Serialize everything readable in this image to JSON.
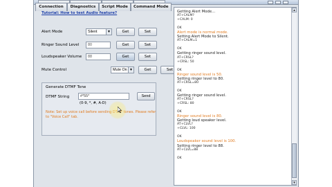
{
  "tabs": {
    "row1": [
      "",
      "",
      "",
      ""
    ],
    "row2": [
      "Connection",
      "Diagnostics",
      "Script Mode",
      "Command Mode"
    ]
  },
  "left": {
    "tutorial_link": "Tutorial: How to test Audio feature?",
    "rows": [
      {
        "label": "Alert Mode",
        "value": "Silent",
        "get": "Get",
        "set": "Set"
      },
      {
        "label": "Ringer Sound Level",
        "value": "80",
        "get": "Get",
        "set": "Set"
      },
      {
        "label": "Loudspeaker Volume",
        "value": "88",
        "get": "Get",
        "set": "Set"
      },
      {
        "label": "Mute Control",
        "value": "Mute On",
        "get": "Get",
        "set": "Set"
      }
    ],
    "dtmf": {
      "title": "Generate DTMF Tone",
      "string_label": "DTMF String",
      "string_value": "#*55*",
      "hint": "(0-9, *, #, A-D)",
      "send": "Send",
      "note": "Note: Set up voice call before sending DTMF tones. Please refer to \"Voice Call\" tab."
    }
  },
  "log": [
    {
      "t": "Getting Alert Mode...",
      "k": "text"
    },
    {
      "t": "AT+CALM?",
      "k": "cmd"
    },
    {
      "t": "+CALM: 0",
      "k": "cmd"
    },
    {
      "t": "",
      "k": "gap"
    },
    {
      "t": "OK",
      "k": "cmd"
    },
    {
      "t": "Alert mode is normal mode.",
      "k": "resp"
    },
    {
      "t": "Setting Alert Mode to Silent.",
      "k": "text"
    },
    {
      "t": "AT+CALM=1",
      "k": "cmd"
    },
    {
      "t": "",
      "k": "gap"
    },
    {
      "t": "OK",
      "k": "cmd"
    },
    {
      "t": "Getting ringer sound level.",
      "k": "text"
    },
    {
      "t": "AT+CRSL?",
      "k": "cmd"
    },
    {
      "t": "+CRSL: 50",
      "k": "cmd"
    },
    {
      "t": "",
      "k": "gap"
    },
    {
      "t": "OK",
      "k": "cmd"
    },
    {
      "t": "Ringer sound level is 50.",
      "k": "resp"
    },
    {
      "t": "Setting ringer level to 80.",
      "k": "text"
    },
    {
      "t": "AT+CRSL=80",
      "k": "cmd"
    },
    {
      "t": "",
      "k": "gap"
    },
    {
      "t": "OK",
      "k": "cmd"
    },
    {
      "t": "Getting ringer sound level.",
      "k": "text"
    },
    {
      "t": "AT+CRSL?",
      "k": "cmd"
    },
    {
      "t": "+CRSL: 80",
      "k": "cmd"
    },
    {
      "t": "",
      "k": "gap"
    },
    {
      "t": "OK",
      "k": "cmd"
    },
    {
      "t": "Ringer sound level is 80.",
      "k": "resp"
    },
    {
      "t": "Getting loud speaker level.",
      "k": "text"
    },
    {
      "t": "AT+CLVL?",
      "k": "cmd"
    },
    {
      "t": "+CLVL: 100",
      "k": "cmd"
    },
    {
      "t": "",
      "k": "gap"
    },
    {
      "t": "OK",
      "k": "cmd"
    },
    {
      "t": "Loudspeaker sound level is 100.",
      "k": "resp"
    },
    {
      "t": "Setting ringer level to 88.",
      "k": "text"
    },
    {
      "t": "AT+CLVL=88",
      "k": "cmd"
    },
    {
      "t": "",
      "k": "gap"
    },
    {
      "t": "OK",
      "k": "cmd"
    }
  ],
  "icons": {
    "scroll_up": "▲",
    "scroll_down": "▼",
    "dropdown": "▼"
  },
  "colors": {
    "response_text": "#e07a1e",
    "link": "#1c3ea8",
    "window_bg": "#dfe4ea"
  }
}
